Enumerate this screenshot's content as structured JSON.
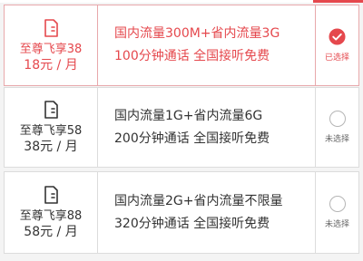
{
  "colors": {
    "accent": "#e5484d",
    "text": "#333333",
    "border": "#dcdcdc"
  },
  "plans": [
    {
      "name": "至尊飞享38",
      "price": "18元 / 月",
      "line1": "国内流量300M+省内流量3G",
      "line2": "100分钟通话   全国接听免费",
      "status": "已选择",
      "selected": true,
      "icon": "sim-card-icon"
    },
    {
      "name": "至尊飞享58",
      "price": "38元 / 月",
      "line1": "国内流量1G+省内流量6G",
      "line2": "200分钟通话   全国接听免费",
      "status": "未选择",
      "selected": false,
      "icon": "sim-card-icon"
    },
    {
      "name": "至尊飞享88",
      "price": "58元 / 月",
      "line1": "国内流量2G+省内流量不限量",
      "line2": "320分钟通话   全国接听免费",
      "status": "未选择",
      "selected": false,
      "icon": "sim-card-icon"
    }
  ]
}
